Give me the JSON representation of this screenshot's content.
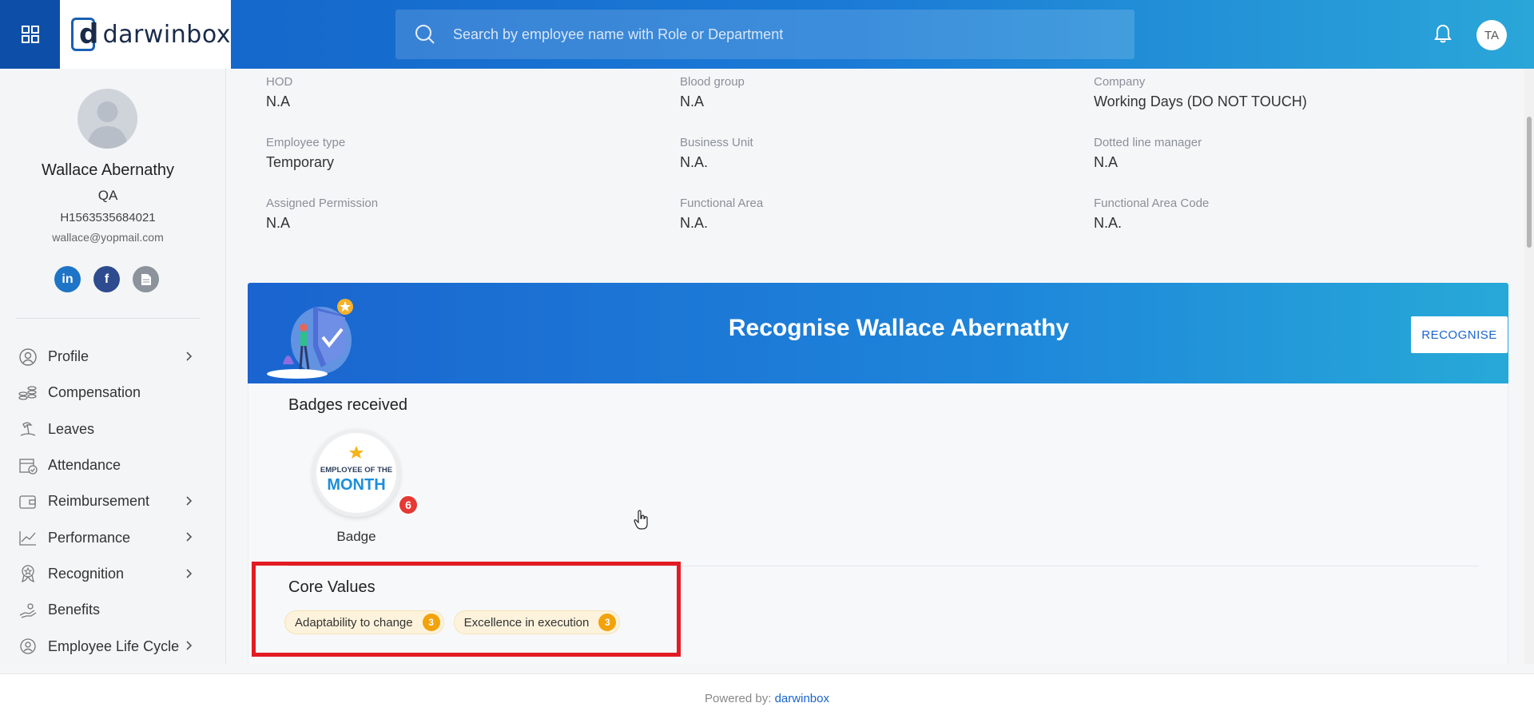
{
  "header": {
    "logo_letter": "d",
    "logo_text": "darwinbox",
    "search_placeholder": "Search by employee name with Role or Department",
    "user_initials": "TA"
  },
  "employee": {
    "name": "Wallace Abernathy",
    "role": "QA",
    "id": "H1563535684021",
    "email": "wallace@yopmail.com",
    "socials": [
      {
        "icon": "linkedin-icon",
        "label": "in",
        "color": "#1e74c6"
      },
      {
        "icon": "facebook-icon",
        "label": "f",
        "color": "#2d4b8e"
      },
      {
        "icon": "document-icon",
        "label": "",
        "color": "#8c939c"
      }
    ]
  },
  "nav": {
    "items": [
      {
        "label": "Profile",
        "icon": "user-icon",
        "has_submenu": true
      },
      {
        "label": "Compensation",
        "icon": "coins-icon",
        "has_submenu": false
      },
      {
        "label": "Leaves",
        "icon": "beach-icon",
        "has_submenu": false
      },
      {
        "label": "Attendance",
        "icon": "calendar-check-icon",
        "has_submenu": false
      },
      {
        "label": "Reimbursement",
        "icon": "wallet-icon",
        "has_submenu": true
      },
      {
        "label": "Performance",
        "icon": "chart-trend-icon",
        "has_submenu": true
      },
      {
        "label": "Recognition",
        "icon": "award-icon",
        "has_submenu": true
      },
      {
        "label": "Benefits",
        "icon": "hand-benefit-icon",
        "has_submenu": false
      },
      {
        "label": "Employee Life Cycle",
        "icon": "lifecycle-icon",
        "has_submenu": true
      }
    ]
  },
  "details": {
    "row1": [
      {
        "label": "HOD",
        "value": "N.A"
      },
      {
        "label": "Blood group",
        "value": "N.A"
      },
      {
        "label": "Company",
        "value": "Working Days (DO NOT TOUCH)"
      }
    ],
    "row2": [
      {
        "label": "Employee type",
        "value": "Temporary"
      },
      {
        "label": "Business Unit",
        "value": "N.A."
      },
      {
        "label": "Dotted line manager",
        "value": "N.A"
      }
    ],
    "row3": [
      {
        "label": "Assigned Permission",
        "value": "N.A"
      },
      {
        "label": "Functional Area",
        "value": "N.A."
      },
      {
        "label": "Functional Area Code",
        "value": "N.A."
      }
    ]
  },
  "recognition": {
    "banner_title": "Recognise Wallace Abernathy",
    "button_label": "RECOGNISE",
    "badges_title": "Badges received",
    "badge": {
      "line1": "EMPLOYEE OF THE",
      "line2": "MONTH",
      "count": "6",
      "label": "Badge"
    },
    "core_values_title": "Core Values",
    "core_values": [
      {
        "label": "Adaptability to change",
        "count": "3"
      },
      {
        "label": "Excellence in execution",
        "count": "3"
      }
    ]
  },
  "footer": {
    "prefix": "Powered by:",
    "brand": "darwinbox"
  },
  "colors": {
    "header_start": "#1261c7",
    "header_end": "#2aa6d8",
    "highlight": "#e31b23",
    "chip_count": "#f2a20c",
    "badge_count": "#e53935"
  }
}
